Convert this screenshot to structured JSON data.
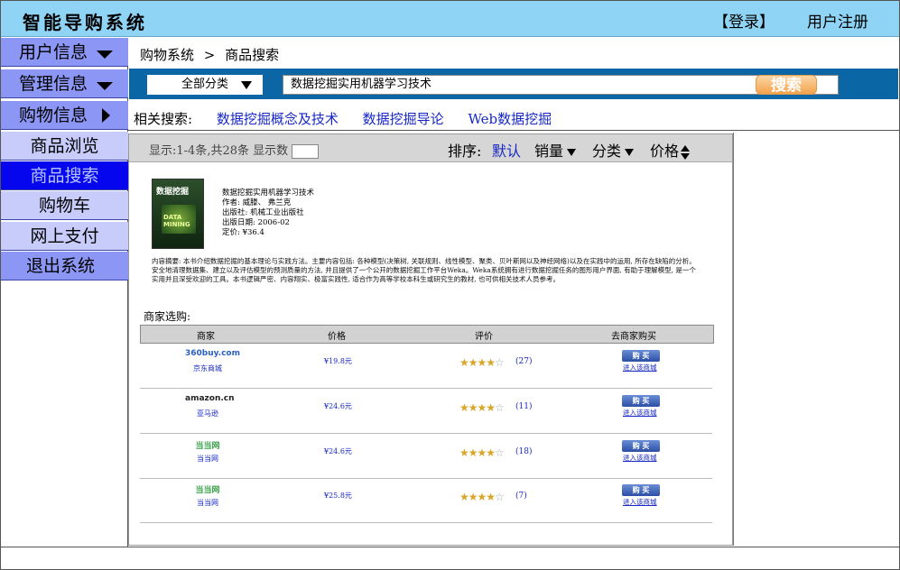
{
  "header": {
    "title": "智能导购系统",
    "login": "【登录】",
    "register": "用户注册"
  },
  "sidebar": {
    "items": [
      {
        "label": "用户信息"
      },
      {
        "label": "管理信息"
      },
      {
        "label": "购物信息"
      },
      {
        "label": "商品浏览"
      },
      {
        "label": "商品搜索"
      },
      {
        "label": "购物车"
      },
      {
        "label": "网上支付"
      },
      {
        "label": "退出系统"
      }
    ]
  },
  "breadcrumb": {
    "root": "购物系统",
    "sep": ">",
    "current": "商品搜索"
  },
  "search": {
    "category": "全部分类",
    "query": "数据挖掘实用机器学习技术",
    "button": "搜索"
  },
  "related": {
    "label": "相关搜索:",
    "links": [
      "数据挖掘概念及技术",
      "数据挖掘导论",
      "Web数据挖掘"
    ]
  },
  "sortbar": {
    "show_info": "显示:1-4条,共28条 显示数",
    "sort_label": "排序:",
    "default": "默认",
    "sales": "销量",
    "category": "分类",
    "price": "价格"
  },
  "book": {
    "cover_title": "数据挖掘",
    "cover_text": "DATA MINING",
    "title": "数据挖掘实用机器学习技术",
    "author": "作者: 威滕、 弗兰克",
    "publisher": "出版社: 机械工业出版社",
    "date": "出版日期: 2006-02",
    "price": "定价: ¥36.4",
    "description": "内容摘要: 本书介绍数据挖掘的基本理论与实践方法。主要内容包括: 各种模型(决策树, 关联规则、线性模型、聚类、贝叶斯网以及神经网络)以及在实践中的运用, 所存在缺陷的分析。安全地清理数据集、建立以及评估模型的预测质量的方法, 并且提供了一个公开的数据挖掘工作平台Weka。Weka系统拥有进行数据挖掘任务的图形用户界面, 有助于理解模型, 是一个实用并且深受欢迎的工具。本书逻辑严密、内容翔实、极富实践性, 适合作为高等学校本科生或研究生的教材, 也可供相关技术人员参考。"
  },
  "merchants": {
    "title": "商家选购:",
    "headers": [
      "商家",
      "价格",
      "评价",
      "去商家购买"
    ],
    "rows": [
      {
        "logo": "360buy.com",
        "logo_color": "#2a5fc0",
        "name": "京东商城",
        "price": "¥19.8元",
        "stars": 4,
        "review": "(27)"
      },
      {
        "logo": "amazon.cn",
        "logo_color": "#222222",
        "name": "亚马逊",
        "price": "¥24.6元",
        "stars": 3.5,
        "review": "(11)"
      },
      {
        "logo": "当当网",
        "logo_color": "#3aa24a",
        "name": "当当网",
        "price": "¥24.6元",
        "stars": 4,
        "review": "(18)"
      },
      {
        "logo": "当当网",
        "logo_color": "#3aa24a",
        "name": "当当网",
        "price": "¥25.8元",
        "stars": 3.5,
        "review": "(7)"
      }
    ],
    "buy_label": "购 买",
    "enter_label": "进入该商城"
  },
  "colors": {
    "header_bg": "#8fd3f5",
    "menu_main": "#8c97f5",
    "menu_sub": "#c7ccfb",
    "menu_active": "#0505ee",
    "searchbar": "#0a66a5",
    "link": "#1727c7"
  }
}
